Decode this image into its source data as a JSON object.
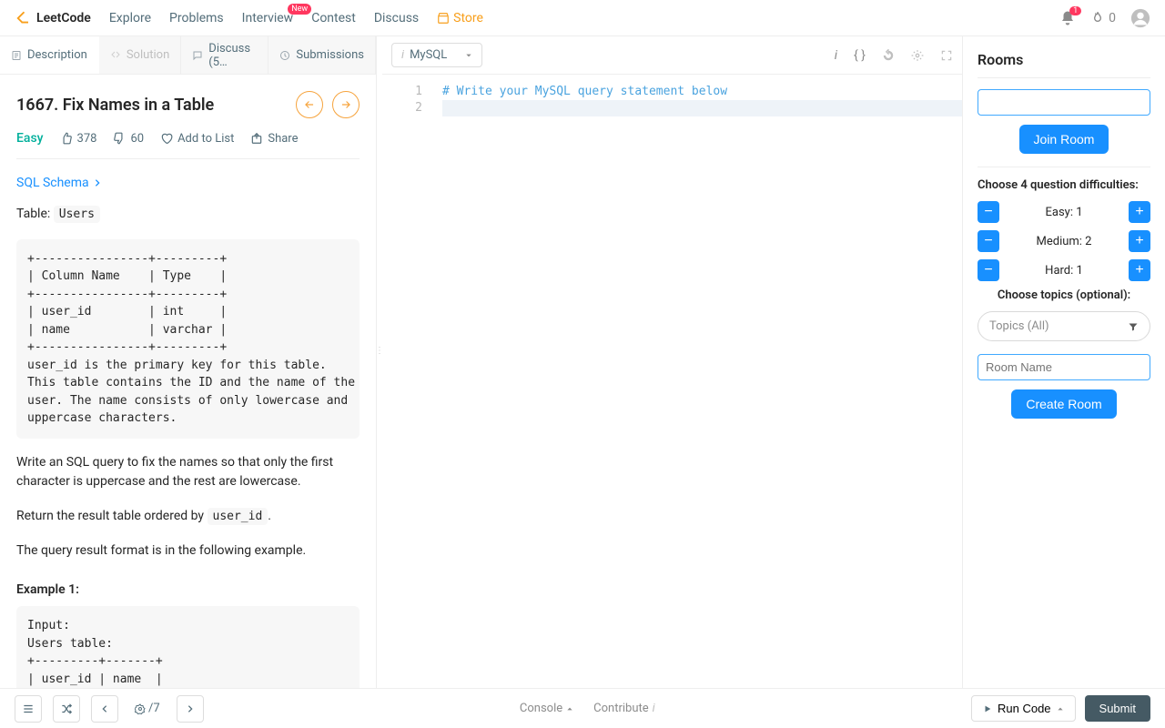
{
  "brand": "LeetCode",
  "nav": {
    "explore": "Explore",
    "problems": "Problems",
    "interview": "Interview",
    "interview_badge": "New",
    "contest": "Contest",
    "discuss": "Discuss",
    "store": "Store"
  },
  "topright": {
    "notif_count": "1",
    "streak": "0"
  },
  "tabs": {
    "description": "Description",
    "solution": "Solution",
    "discuss": "Discuss (5…",
    "submissions": "Submissions"
  },
  "problem": {
    "title": "1667. Fix Names in a Table",
    "difficulty": "Easy",
    "likes": "378",
    "dislikes": "60",
    "add_to_list": "Add to List",
    "share": "Share",
    "schema_link": "SQL Schema",
    "table_label": "Table:",
    "table_name": "Users",
    "schema_block": "+----------------+---------+\n| Column Name    | Type    |\n+----------------+---------+\n| user_id        | int     |\n| name           | varchar |\n+----------------+---------+\nuser_id is the primary key for this table.\nThis table contains the ID and the name of the\nuser. The name consists of only lowercase and\nuppercase characters.",
    "para1": "Write an SQL query to fix the names so that only the first character is uppercase and the rest are lowercase.",
    "para2a": "Return the result table ordered by ",
    "para2code": "user_id",
    "para2b": ".",
    "para3": "The query result format is in the following example.",
    "example_label": "Example 1:",
    "example_block": "Input:\nUsers table:\n+---------+-------+\n| user_id | name  |\n+---------+-------+"
  },
  "editor": {
    "language": "MySQL",
    "lines": [
      "1",
      "2"
    ],
    "code_line1": "# Write your MySQL query statement below"
  },
  "rooms": {
    "title": "Rooms",
    "join_btn": "Join Room",
    "choose_diff": "Choose 4 question difficulties:",
    "easy": "Easy: 1",
    "medium": "Medium: 2",
    "hard": "Hard: 1",
    "choose_topics": "Choose topics (optional):",
    "topics_placeholder": "Topics (All)",
    "room_name_placeholder": "Room Name",
    "create_btn": "Create Room"
  },
  "bottom": {
    "progress": "/7",
    "console": "Console",
    "contribute": "Contribute",
    "run": "Run Code",
    "submit": "Submit"
  }
}
